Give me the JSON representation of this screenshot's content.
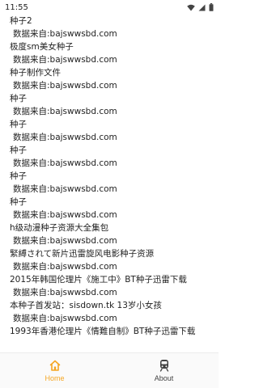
{
  "status_bar": {
    "time": "11:55",
    "icons": [
      "wifi-icon",
      "signal-icon",
      "battery-icon"
    ]
  },
  "list": {
    "items": [
      {
        "title": "种子2",
        "source": "数据来自:bajswwsbd.com"
      },
      {
        "title": "极度sm美女种子",
        "source": "数据来自:bajswwsbd.com"
      },
      {
        "title": "种子制作文件",
        "source": "数据来自:bajswwsbd.com"
      },
      {
        "title": "种子",
        "source": "数据来自:bajswwsbd.com"
      },
      {
        "title": "种子",
        "source": "数据来自:bajswwsbd.com"
      },
      {
        "title": "种子",
        "source": "数据来自:bajswwsbd.com"
      },
      {
        "title": "种子",
        "source": "数据来自:bajswwsbd.com"
      },
      {
        "title": "种子",
        "source": "数据来自:bajswwsbd.com"
      },
      {
        "title": "h级动漫种子资源大全集包",
        "source": "数据来自:bajswwsbd.com"
      },
      {
        "title": "緊縛されて新片迅雷旋风电影种子资源",
        "source": "数据来自:bajswwsbd.com"
      },
      {
        "title": "2015年韩国伦理片《施工中》BT种子迅雷下载",
        "source": "数据来自:bajswwsbd.com"
      },
      {
        "title": "本种子首发站：sisdown.tk  13岁小女孩",
        "source": "数据来自:bajswwsbd.com"
      },
      {
        "title": "1993年香港伦理片《情難自制》BT种子迅雷下载",
        "source": ""
      }
    ]
  },
  "bottom_nav": {
    "home_label": "Home",
    "about_label": "About",
    "home_icon": "home-icon",
    "about_icon": "train-icon",
    "accent_color": "#f5a623"
  }
}
